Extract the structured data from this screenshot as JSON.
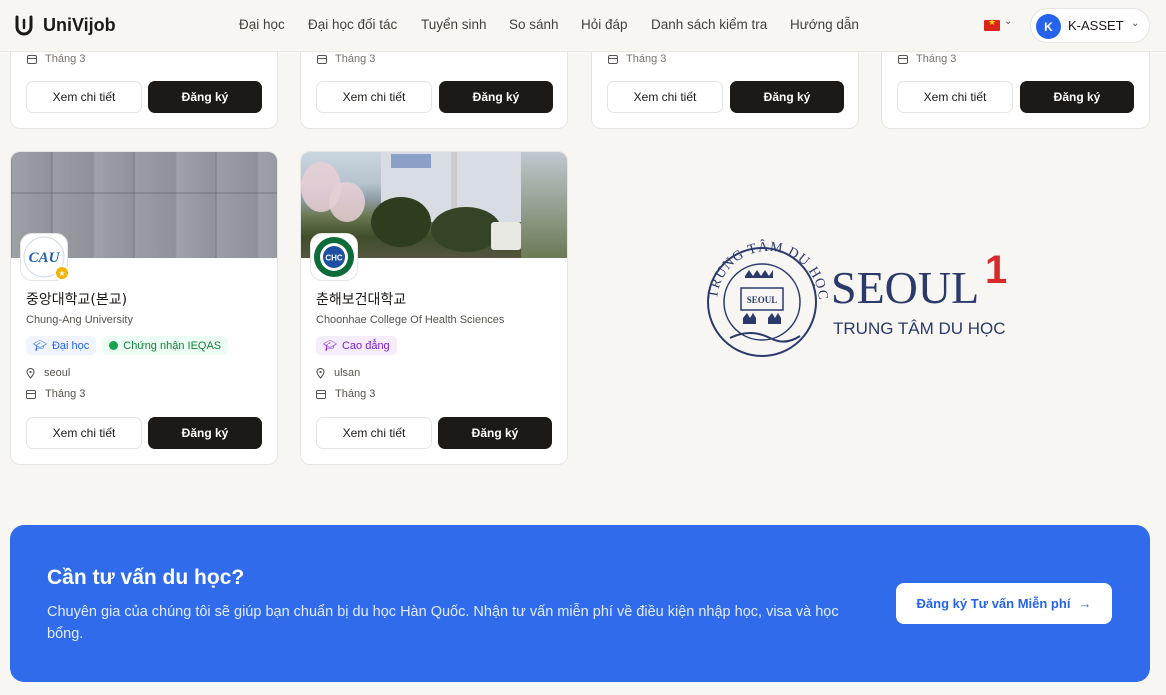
{
  "header": {
    "brand": "UniVijob",
    "nav": [
      "Đại học",
      "Đại học đối tác",
      "Tuyển sinh",
      "So sánh",
      "Hỏi đáp",
      "Danh sách kiểm tra",
      "Hướng dẫn"
    ],
    "user": {
      "initial": "K",
      "name": "K-ASSET"
    }
  },
  "top_cards": [
    {
      "month": "Tháng 3",
      "detail_label": "Xem chi tiết",
      "register_label": "Đăng ký"
    },
    {
      "month": "Tháng 3",
      "detail_label": "Xem chi tiết",
      "register_label": "Đăng ký"
    },
    {
      "month": "Tháng 3",
      "detail_label": "Xem chi tiết",
      "register_label": "Đăng ký"
    },
    {
      "month": "Tháng 3",
      "detail_label": "Xem chi tiết",
      "register_label": "Đăng ký"
    }
  ],
  "universities": [
    {
      "name_ko": "중앙대학교(본교)",
      "name_en": "Chung-Ang University",
      "logo_text": "CAU",
      "tags": [
        "Đại học",
        "Chứng nhận IEQAS"
      ],
      "location": "seoul",
      "month": "Tháng 3",
      "detail_label": "Xem chi tiết",
      "register_label": "Đăng ký"
    },
    {
      "name_ko": "춘해보건대학교",
      "name_en": "Choonhae College Of Health Sciences",
      "logo_text": "CHC",
      "tags": [
        "Cao đẳng"
      ],
      "location": "ulsan",
      "month": "Tháng 3",
      "detail_label": "Xem chi tiết",
      "register_label": "Đăng ký"
    }
  ],
  "promo": {
    "brand": "SEOUL",
    "brand_number": "1",
    "tagline": "TRUNG TÂM DU HỌC",
    "seal_text": "TRUNG TÂM DU HỌC",
    "seal_center": "SEOUL"
  },
  "banner": {
    "title": "Cần tư vấn du học?",
    "description": "Chuyên gia của chúng tôi sẽ giúp bạn chuẩn bị du học Hàn Quốc. Nhận tư vấn miễn phí về điều kiện nhập học, visa và học bổng.",
    "button_label": "Đăng ký Tư vấn Miễn phí"
  },
  "colors": {
    "primary": "#2f6bea",
    "dark_button": "#1c1917",
    "seoul_navy": "#2b3a6b",
    "seoul_red": "#d62b2b"
  }
}
